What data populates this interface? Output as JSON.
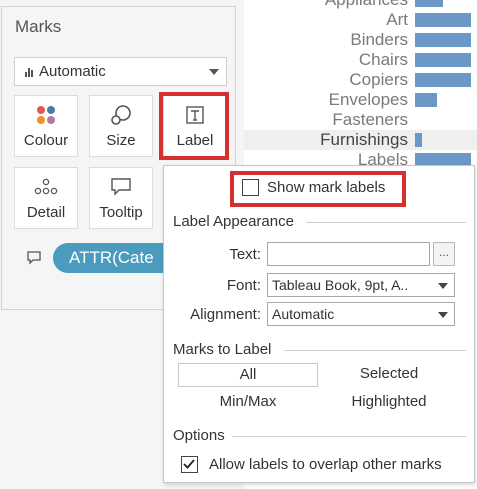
{
  "marks": {
    "title": "Marks",
    "mark_type": "Automatic",
    "buttons": {
      "colour": "Colour",
      "size": "Size",
      "label": "Label",
      "detail": "Detail",
      "tooltip": "Tooltip"
    },
    "pill": "ATTR(Cate"
  },
  "chart": {
    "categories": [
      "Appliances",
      "Art",
      "Binders",
      "Chairs",
      "Copiers",
      "Envelopes",
      "Fasteners",
      "Furnishings",
      "Labels"
    ],
    "bar_values": [
      0.45,
      0.9,
      0.9,
      0.9,
      0.9,
      0.35,
      0.0,
      0.12,
      0.9
    ],
    "highlighted_category": "Furnishings",
    "bar_color": "#6b97c6"
  },
  "label_popup": {
    "show_mark_labels": "Show mark labels",
    "show_mark_labels_checked": false,
    "appearance_title": "Label Appearance",
    "text_label": "Text:",
    "text_value": "",
    "ellipsis": "...",
    "font_label": "Font:",
    "font_value": "Tableau Book, 9pt, A..",
    "alignment_label": "Alignment:",
    "alignment_value": "Automatic",
    "marks_to_label_title": "Marks to Label",
    "options_all": "All",
    "options_selected": "Selected",
    "options_minmax": "Min/Max",
    "options_highlighted": "Highlighted",
    "options_title": "Options",
    "overlap_label": "Allow labels to overlap other marks",
    "overlap_checked": true
  },
  "accent_colors": {
    "highlight_box": "#d62f2f",
    "pill": "#4a9bbd"
  }
}
